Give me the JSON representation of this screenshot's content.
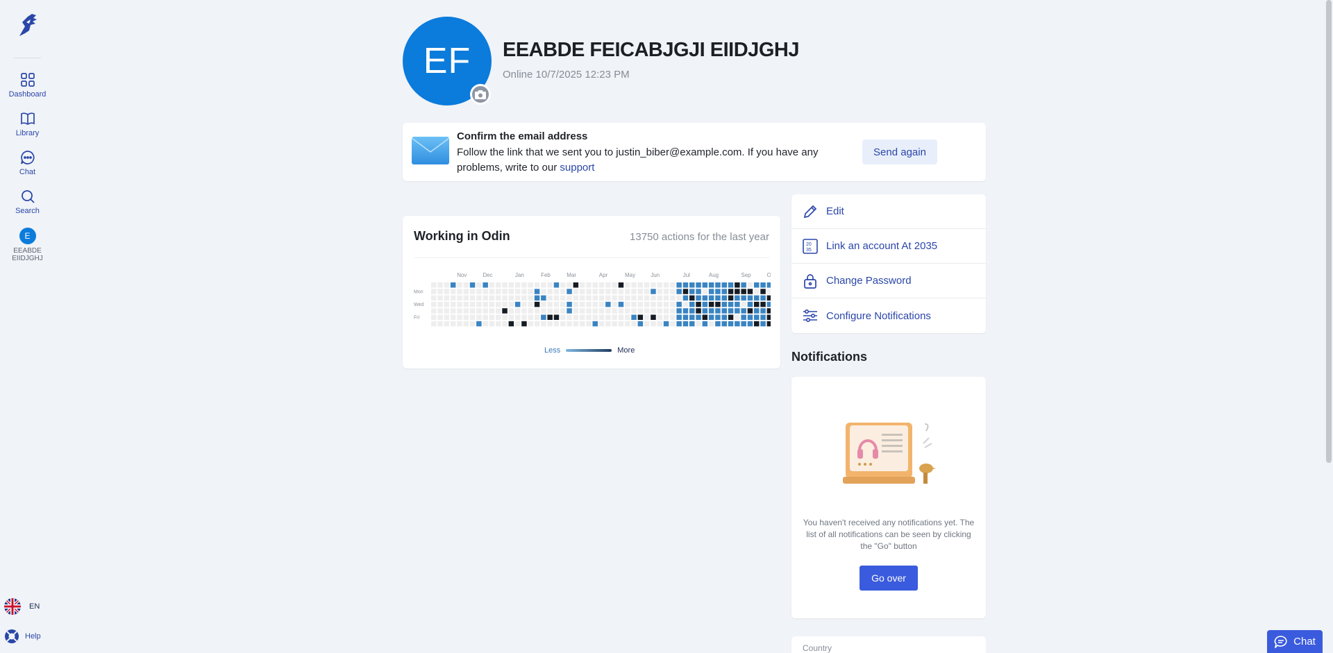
{
  "sidebar": {
    "items": [
      {
        "label": "Dashboard",
        "icon": "grid-icon"
      },
      {
        "label": "Library",
        "icon": "book-icon"
      },
      {
        "label": "Chat",
        "icon": "chat-icon"
      },
      {
        "label": "Search",
        "icon": "search-icon"
      }
    ],
    "user": {
      "initial": "E",
      "name": "EEABDE EIIDJGHJ"
    },
    "language": "EN",
    "help": "Help"
  },
  "profile": {
    "initials": "EF",
    "name": "EEABDE FEICABJGJI EIIDJGHJ",
    "status": "Online 10/7/2025 12:23 PM"
  },
  "email_banner": {
    "title": "Confirm the email address",
    "text": "Follow the link that we sent you to justin_biber@example.com. If you have any problems, write to our ",
    "link": "support",
    "button": "Send again"
  },
  "activity": {
    "title": "Working in Odin",
    "count": "13750 actions for the last year",
    "months": [
      "Nov",
      "Dec",
      "Jan",
      "Feb",
      "Mar",
      "Apr",
      "May",
      "Jun",
      "Jul",
      "Aug",
      "Sep",
      "Oct"
    ],
    "days": [
      "Mon",
      "Wed",
      "Fri"
    ],
    "legend_less": "Less",
    "legend_more": "More",
    "colors": {
      "empty": "#eeeeee",
      "light": "#3a84c2",
      "dark": "#161c24"
    }
  },
  "actions": [
    {
      "label": "Edit",
      "icon": "pencil-icon"
    },
    {
      "label": "Link an account At 2035",
      "icon": "qr-icon"
    },
    {
      "label": "Change Password",
      "icon": "lock-icon"
    },
    {
      "label": "Configure Notifications",
      "icon": "sliders-icon"
    }
  ],
  "notifications": {
    "heading": "Notifications",
    "empty_text": "You haven't received any notifications yet. The list of all notifications can be seen by clicking the \"Go\" button",
    "button": "Go over"
  },
  "country": {
    "label": "Country"
  },
  "chat_button": "Chat",
  "accent": "#2a46a8"
}
